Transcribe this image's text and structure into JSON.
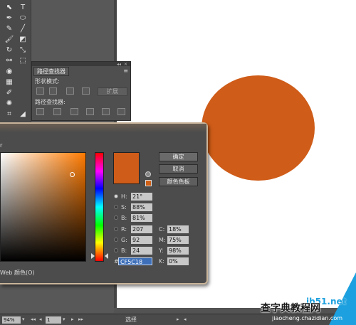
{
  "pathfinder": {
    "tab_label": "路径查找器",
    "shape_modes_label": "形状模式:",
    "pathfinders_label": "路径查找器:",
    "expand_label": "扩展",
    "collapse_glyph": "◂◂",
    "close_glyph": "✕",
    "menu_glyph": "≡"
  },
  "color_picker": {
    "title_fragment": "r",
    "buttons": {
      "ok": "确定",
      "cancel": "取消",
      "swatches": "颜色色板"
    },
    "fields": {
      "H": {
        "label": "H:",
        "value": "21°"
      },
      "S": {
        "label": "S:",
        "value": "88%"
      },
      "B": {
        "label": "B:",
        "value": "81%"
      },
      "R": {
        "label": "R:",
        "value": "207"
      },
      "G": {
        "label": "G:",
        "value": "92"
      },
      "Bl": {
        "label": "B:",
        "value": "24"
      },
      "hex": {
        "label": "#",
        "value": "CF5C18"
      },
      "C": {
        "label": "C:",
        "value": "18%"
      },
      "M": {
        "label": "M:",
        "value": "75%"
      },
      "Y": {
        "label": "Y:",
        "value": "98%"
      },
      "K": {
        "label": "K:",
        "value": "0%"
      }
    },
    "selected_field": "H",
    "web_only_label": "Web 颜色(O)",
    "current_color": "#cf5c18"
  },
  "artboard": {
    "circle_color": "#cf5c18"
  },
  "statusbar": {
    "zoom": "94%",
    "artboard_number": "1",
    "tool_name": "选择"
  },
  "watermark": {
    "main": "查字典",
    "site": "ib51.net",
    "tutorial": "教程网",
    "url": "jiaocheng.chazidian.com"
  }
}
